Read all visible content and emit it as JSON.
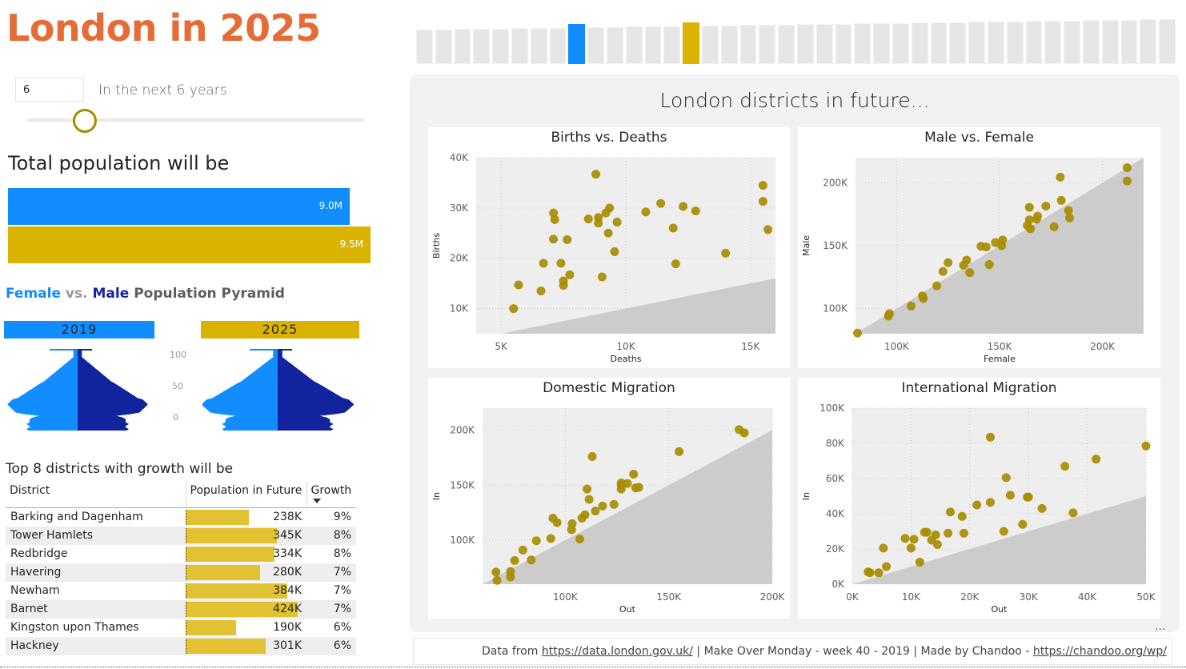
{
  "title": "London in 2025",
  "years_selector": {
    "value": "6",
    "label": "In the next 6 years",
    "slider_fraction": 0.17
  },
  "total_population": {
    "heading": "Total population will be",
    "bars": [
      {
        "year": "2019",
        "value": 9.0,
        "label": "9.0M",
        "color": "#118DFF"
      },
      {
        "year": "2025",
        "value": 9.5,
        "label": "9.5M",
        "color": "#D9B300"
      }
    ]
  },
  "pyramid": {
    "heading_female": "Female",
    "heading_vs": "vs.",
    "heading_male": "Male",
    "heading_rest": "Population Pyramid",
    "year_left": "2019",
    "year_right": "2025",
    "age_ticks": [
      "100",
      "50",
      "0"
    ],
    "colors": {
      "female": "#118DFF",
      "male": "#12239E"
    }
  },
  "timeline": {
    "bar_count": 40,
    "highlight_start_index": 8,
    "highlight_end_index": 14,
    "colors": {
      "base": "#E6E6E6",
      "start": "#118DFF",
      "end": "#D9B300"
    }
  },
  "districts_table": {
    "heading": "Top 8 districts with growth will be",
    "columns": [
      "District",
      "Population in Future",
      "Growth"
    ],
    "sort_column": "Growth",
    "rows": [
      {
        "district": "Barking and Dagenham",
        "population": 238,
        "population_label": "238K",
        "growth": "9%"
      },
      {
        "district": "Tower Hamlets",
        "population": 345,
        "population_label": "345K",
        "growth": "8%"
      },
      {
        "district": "Redbridge",
        "population": 334,
        "population_label": "334K",
        "growth": "8%"
      },
      {
        "district": "Havering",
        "population": 280,
        "population_label": "280K",
        "growth": "7%"
      },
      {
        "district": "Newham",
        "population": 384,
        "population_label": "384K",
        "growth": "7%"
      },
      {
        "district": "Barnet",
        "population": 424,
        "population_label": "424K",
        "growth": "7%"
      },
      {
        "district": "Kingston upon Thames",
        "population": 190,
        "population_label": "190K",
        "growth": "6%"
      },
      {
        "district": "Hackney",
        "population": 301,
        "population_label": "301K",
        "growth": "6%"
      }
    ]
  },
  "panel": {
    "title": "London districts in future...",
    "more_label": "..."
  },
  "chart_data": [
    {
      "type": "scatter",
      "title": "Births vs. Deaths",
      "xlabel": "Deaths",
      "ylabel": "Births",
      "xlim": [
        4000,
        16000
      ],
      "ylim": [
        5000,
        40000
      ],
      "xticks": [
        5000,
        10000,
        15000
      ],
      "xtick_labels": [
        "5K",
        "10K",
        "15K"
      ],
      "yticks": [
        10000,
        20000,
        30000,
        40000
      ],
      "ytick_labels": [
        "10K",
        "20K",
        "30K",
        "40K"
      ],
      "reference": "y=x",
      "points": [
        [
          5500,
          10000
        ],
        [
          5700,
          14700
        ],
        [
          6600,
          13500
        ],
        [
          6700,
          19000
        ],
        [
          7100,
          29000
        ],
        [
          7150,
          27700
        ],
        [
          7100,
          23800
        ],
        [
          7400,
          19000
        ],
        [
          7500,
          15500
        ],
        [
          7500,
          14600
        ],
        [
          7650,
          23700
        ],
        [
          7750,
          16700
        ],
        [
          8500,
          27800
        ],
        [
          8800,
          36700
        ],
        [
          8900,
          28100
        ],
        [
          8900,
          27000
        ],
        [
          9200,
          29000
        ],
        [
          9350,
          30000
        ],
        [
          9300,
          25000
        ],
        [
          9550,
          21300
        ],
        [
          9650,
          27200
        ],
        [
          9050,
          16300
        ],
        [
          10800,
          29200
        ],
        [
          11400,
          30900
        ],
        [
          12300,
          30300
        ],
        [
          12800,
          29400
        ],
        [
          11900,
          26000
        ],
        [
          12000,
          18900
        ],
        [
          14000,
          21000
        ],
        [
          15500,
          34500
        ],
        [
          15500,
          31300
        ],
        [
          15700,
          25700
        ]
      ],
      "grid": true,
      "color": "#A88C00"
    },
    {
      "type": "scatter",
      "title": "Male vs. Female",
      "xlabel": "Female",
      "ylabel": "Male",
      "xlim": [
        80000,
        220000
      ],
      "ylim": [
        80000,
        220000
      ],
      "xticks": [
        100000,
        150000,
        200000
      ],
      "xtick_labels": [
        "100K",
        "150K",
        "200K"
      ],
      "yticks": [
        100000,
        150000,
        200000
      ],
      "ytick_labels": [
        "100K",
        "150K",
        "200K"
      ],
      "reference": "y=x",
      "points": [
        [
          81000,
          80500
        ],
        [
          96000,
          94000
        ],
        [
          96500,
          96000
        ],
        [
          107000,
          102000
        ],
        [
          112500,
          110000
        ],
        [
          113000,
          108000
        ],
        [
          119500,
          118000
        ],
        [
          122500,
          129500
        ],
        [
          125000,
          136500
        ],
        [
          132500,
          134500
        ],
        [
          134000,
          138500
        ],
        [
          135500,
          128500
        ],
        [
          141000,
          149500
        ],
        [
          143500,
          149000
        ],
        [
          145000,
          135000
        ],
        [
          148000,
          152500
        ],
        [
          151000,
          150000
        ],
        [
          151500,
          154500
        ],
        [
          163500,
          166000
        ],
        [
          164500,
          180500
        ],
        [
          164500,
          170500
        ],
        [
          165000,
          163500
        ],
        [
          168000,
          171000
        ],
        [
          168500,
          173500
        ],
        [
          172500,
          181500
        ],
        [
          176500,
          165000
        ],
        [
          179500,
          204500
        ],
        [
          180000,
          186000
        ],
        [
          183500,
          178000
        ],
        [
          184000,
          172000
        ],
        [
          212000,
          212000
        ],
        [
          212000,
          201500
        ]
      ],
      "grid": true,
      "color": "#A88C00"
    },
    {
      "type": "scatter",
      "title": "Domestic Migration",
      "xlabel": "Out",
      "ylabel": "In",
      "xlim": [
        60000,
        200000
      ],
      "ylim": [
        60000,
        220000
      ],
      "xticks": [
        100000,
        150000,
        200000
      ],
      "xtick_labels": [
        "100K",
        "150K",
        "200K"
      ],
      "yticks": [
        100000,
        150000,
        200000
      ],
      "ytick_labels": [
        "100K",
        "150K",
        "200K"
      ],
      "reference": "y=x",
      "points": [
        [
          66500,
          71000
        ],
        [
          67000,
          63500
        ],
        [
          73500,
          71500
        ],
        [
          73500,
          66500
        ],
        [
          75500,
          81500
        ],
        [
          79500,
          91000
        ],
        [
          83500,
          82000
        ],
        [
          86000,
          99500
        ],
        [
          93000,
          101500
        ],
        [
          94000,
          120000
        ],
        [
          96000,
          116000
        ],
        [
          103000,
          109500
        ],
        [
          103300,
          115000
        ],
        [
          107000,
          101000
        ],
        [
          108000,
          120000
        ],
        [
          109500,
          123000
        ],
        [
          110500,
          146500
        ],
        [
          111500,
          137000
        ],
        [
          113000,
          176000
        ],
        [
          114500,
          126500
        ],
        [
          118000,
          131000
        ],
        [
          123500,
          132500
        ],
        [
          127000,
          150000
        ],
        [
          127000,
          152000
        ],
        [
          127000,
          146500
        ],
        [
          130000,
          151500
        ],
        [
          133000,
          160000
        ],
        [
          134000,
          147500
        ],
        [
          135500,
          148000
        ],
        [
          155000,
          180500
        ],
        [
          184000,
          200500
        ],
        [
          186500,
          197500
        ]
      ],
      "grid": true,
      "color": "#A88C00"
    },
    {
      "type": "scatter",
      "title": "International Migration",
      "xlabel": "Out",
      "ylabel": "In",
      "xlim": [
        0,
        50000
      ],
      "ylim": [
        0,
        100000
      ],
      "xticks": [
        0,
        10000,
        20000,
        30000,
        40000,
        50000
      ],
      "xtick_labels": [
        "0K",
        "10K",
        "20K",
        "30K",
        "40K",
        "50K"
      ],
      "yticks": [
        0,
        20000,
        40000,
        60000,
        80000,
        100000
      ],
      "ytick_labels": [
        "0K",
        "20K",
        "40K",
        "60K",
        "80K",
        "100K"
      ],
      "reference": "y=x",
      "points": [
        [
          2700,
          7000
        ],
        [
          3000,
          6500
        ],
        [
          4500,
          6500
        ],
        [
          5300,
          20500
        ],
        [
          5800,
          10000
        ],
        [
          9000,
          26000
        ],
        [
          10000,
          20500
        ],
        [
          10500,
          25500
        ],
        [
          11500,
          12500
        ],
        [
          12300,
          29500
        ],
        [
          12700,
          29500
        ],
        [
          13500,
          25000
        ],
        [
          14200,
          28000
        ],
        [
          14500,
          22500
        ],
        [
          16300,
          29000
        ],
        [
          16700,
          41000
        ],
        [
          18700,
          38500
        ],
        [
          19000,
          29000
        ],
        [
          21200,
          45000
        ],
        [
          23500,
          83500
        ],
        [
          23500,
          46500
        ],
        [
          25800,
          30000
        ],
        [
          26200,
          60500
        ],
        [
          26900,
          50500
        ],
        [
          29000,
          34000
        ],
        [
          29800,
          49500
        ],
        [
          30000,
          49500
        ],
        [
          32300,
          43000
        ],
        [
          36200,
          67000
        ],
        [
          37600,
          40500
        ],
        [
          41500,
          71000
        ],
        [
          50000,
          78500
        ]
      ],
      "grid": true,
      "color": "#A88C00"
    }
  ],
  "footer": {
    "prefix": "Data from ",
    "link1": "https://data.london.gov.uk/",
    "middle": " | Make Over Monday - week 40 - 2019 | Made by Chandoo - ",
    "link2": "https://chandoo.org/wp/"
  }
}
